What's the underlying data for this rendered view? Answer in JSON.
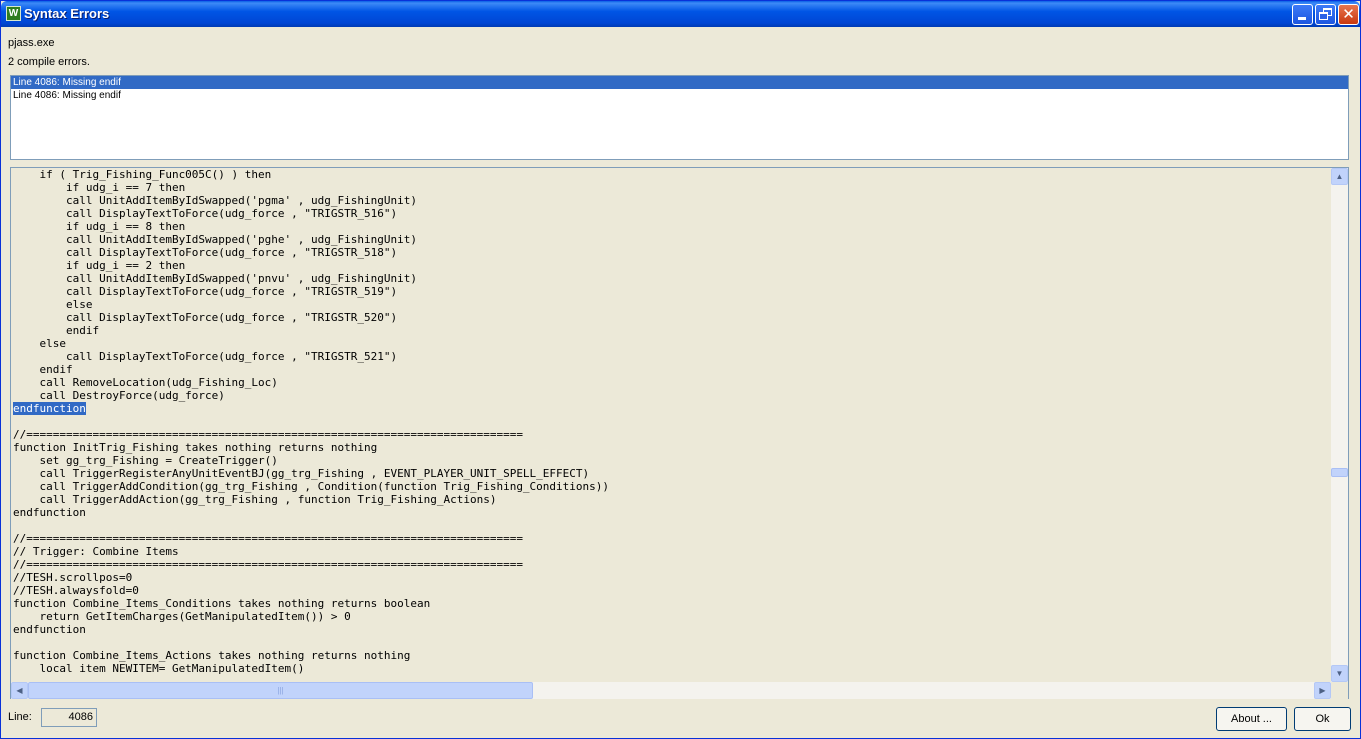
{
  "window": {
    "title": "Syntax Errors",
    "icon_label": "W"
  },
  "header": {
    "exe_label": "pjass.exe",
    "error_count_label": "2 compile errors."
  },
  "errors": [
    {
      "text": "Line 4086:  Missing endif",
      "selected": true
    },
    {
      "text": "Line 4086:  Missing endif",
      "selected": false
    }
  ],
  "code_lines": [
    "    if ( Trig_Fishing_Func005C() ) then",
    "        if udg_i == 7 then",
    "        call UnitAddItemByIdSwapped('pgma' , udg_FishingUnit)",
    "        call DisplayTextToForce(udg_force , \"TRIGSTR_516\")",
    "        if udg_i == 8 then",
    "        call UnitAddItemByIdSwapped('pghe' , udg_FishingUnit)",
    "        call DisplayTextToForce(udg_force , \"TRIGSTR_518\")",
    "        if udg_i == 2 then",
    "        call UnitAddItemByIdSwapped('pnvu' , udg_FishingUnit)",
    "        call DisplayTextToForce(udg_force , \"TRIGSTR_519\")",
    "        else",
    "        call DisplayTextToForce(udg_force , \"TRIGSTR_520\")",
    "        endif",
    "    else",
    "        call DisplayTextToForce(udg_force , \"TRIGSTR_521\")",
    "    endif",
    "    call RemoveLocation(udg_Fishing_Loc)",
    "    call DestroyForce(udg_force)",
    "endfunction",
    "",
    "//===========================================================================",
    "function InitTrig_Fishing takes nothing returns nothing",
    "    set gg_trg_Fishing = CreateTrigger()",
    "    call TriggerRegisterAnyUnitEventBJ(gg_trg_Fishing , EVENT_PLAYER_UNIT_SPELL_EFFECT)",
    "    call TriggerAddCondition(gg_trg_Fishing , Condition(function Trig_Fishing_Conditions))",
    "    call TriggerAddAction(gg_trg_Fishing , function Trig_Fishing_Actions)",
    "endfunction",
    "",
    "//===========================================================================",
    "// Trigger: Combine Items",
    "//===========================================================================",
    "//TESH.scrollpos=0",
    "//TESH.alwaysfold=0",
    "function Combine_Items_Conditions takes nothing returns boolean",
    "    return GetItemCharges(GetManipulatedItem()) > 0",
    "endfunction",
    "",
    "function Combine_Items_Actions takes nothing returns nothing",
    "    local item NEWITEM= GetManipulatedItem()"
  ],
  "highlighted_line_index": 18,
  "footer": {
    "line_label": "Line:",
    "line_value": "4086",
    "about_button": "About ...",
    "ok_button": "Ok"
  },
  "icons": [
    "minimize-icon",
    "maximize-icon",
    "close-icon",
    "scroll-up-icon",
    "scroll-down-icon",
    "scroll-left-icon",
    "scroll-right-icon"
  ],
  "colors": {
    "titlebar": "#0055e5",
    "selection": "#316ac5",
    "window_bg": "#ece9d8"
  }
}
